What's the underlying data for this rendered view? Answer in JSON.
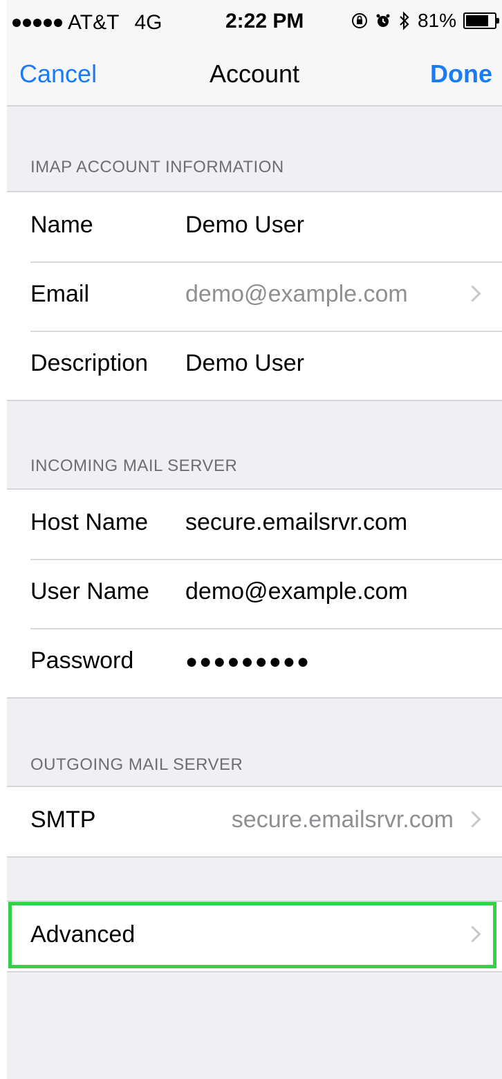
{
  "status_bar": {
    "carrier": "AT&T",
    "network": "4G",
    "time": "2:22 PM",
    "battery_percent": "81%",
    "battery_level": 0.81,
    "icons": [
      "orientation-lock-icon",
      "alarm-icon",
      "bluetooth-icon",
      "battery-icon"
    ]
  },
  "nav": {
    "cancel_label": "Cancel",
    "title": "Account",
    "done_label": "Done",
    "accent_color": "#1a7cf2"
  },
  "imap_section": {
    "header": "IMAP ACCOUNT INFORMATION",
    "rows": [
      {
        "label": "Name",
        "value": "Demo User"
      },
      {
        "label": "Email",
        "value": "demo@example.com"
      },
      {
        "label": "Description",
        "value": "Demo User"
      }
    ]
  },
  "incoming_section": {
    "header": "INCOMING MAIL SERVER",
    "rows": [
      {
        "label": "Host Name",
        "value": "secure.emailsrvr.com"
      },
      {
        "label": "User Name",
        "value": "demo@example.com"
      },
      {
        "label": "Password",
        "value": "●●●●●●●●●"
      }
    ]
  },
  "outgoing_section": {
    "header": "OUTGOING MAIL SERVER",
    "rows": [
      {
        "label": "SMTP",
        "value": "secure.emailsrvr.com"
      }
    ]
  },
  "advanced": {
    "label": "Advanced",
    "highlight_color": "#35d04a"
  }
}
